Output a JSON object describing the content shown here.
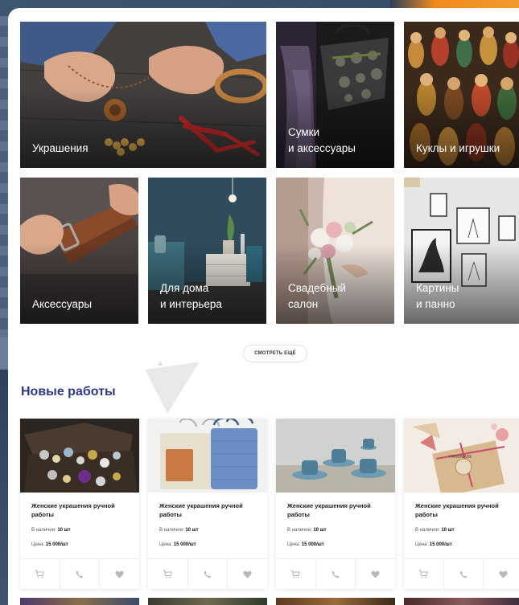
{
  "categories": [
    {
      "label": "Украшения"
    },
    {
      "label": "Сумки\nи аксессуары"
    },
    {
      "label": "Куклы и игрушки"
    },
    {
      "label": "Аксессуары"
    },
    {
      "label": "Для дома\nи интерьера"
    },
    {
      "label": "Свадебный\nсалон"
    },
    {
      "label": "Картины\nи панно"
    }
  ],
  "more_button": "СМОТРЕТЬ ЕЩЁ",
  "new_works": {
    "title": "Новые работы",
    "products": [
      {
        "title": "Женские украшения ручной работы",
        "stock_label": "В наличии:",
        "stock_value": "10 шт",
        "price_label": "Цена:",
        "price_value": "15 000/шт"
      },
      {
        "title": "Женские украшения ручной работы",
        "stock_label": "В наличии:",
        "stock_value": "10 шт",
        "price_label": "Цена:",
        "price_value": "15 000/шт"
      },
      {
        "title": "Женские украшения ручной работы",
        "stock_label": "В наличии:",
        "stock_value": "10 шт",
        "price_label": "Цена:",
        "price_value": "15 000/шт"
      },
      {
        "title": "Женские украшения ручной работы",
        "stock_label": "В наличии:",
        "stock_value": "10 шт",
        "price_label": "Цена:",
        "price_value": "15 000/шт"
      }
    ],
    "card_icons": [
      "cart-icon",
      "phone-icon",
      "heart-icon"
    ],
    "photo_tag": "HANDMADE"
  },
  "colors": {
    "accent_orange": "#f28a1e",
    "title_blue": "#2c3987",
    "icon_gray": "#b9b9b9"
  }
}
